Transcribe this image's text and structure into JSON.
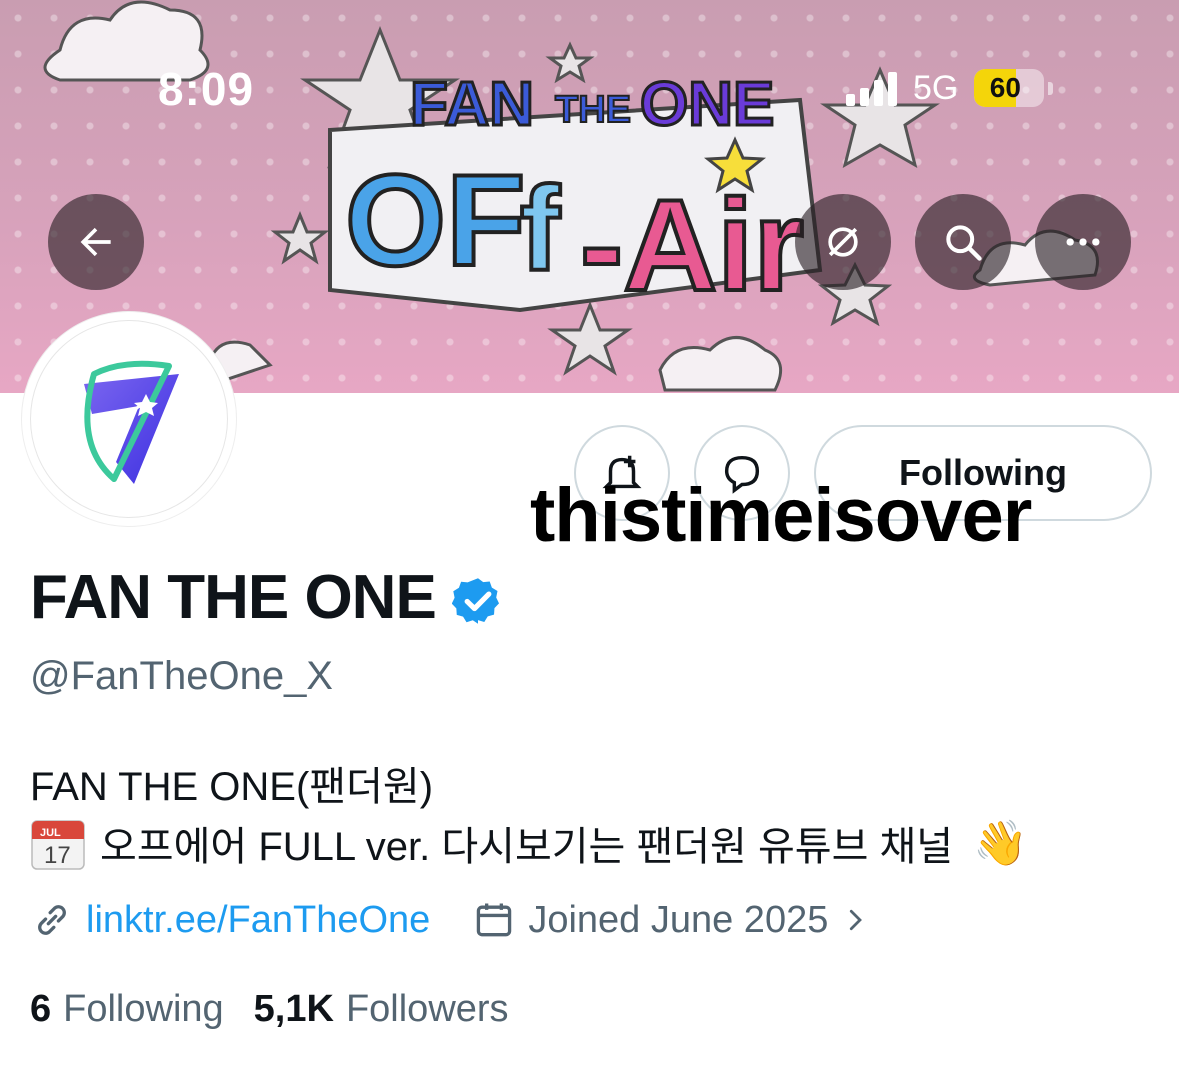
{
  "status_bar": {
    "time": "8:09",
    "network": "5G",
    "battery": "60",
    "battery_level": 0.6
  },
  "banner": {
    "title_top": "FAN THE ONE",
    "title_main": "OFF-Air"
  },
  "profile": {
    "display_name": "FAN THE ONE",
    "handle": "@FanTheOne_X",
    "bio_line1": "FAN THE ONE(팬더원)",
    "bio_line2": "오프에어 FULL ver. 다시보기는 팬더원 유튜브 채널",
    "calendar_emoji_month": "JUL",
    "calendar_emoji_day": "17",
    "wave_emoji": "👋",
    "link": "linktr.ee/FanTheOne",
    "joined": "Joined June 2025",
    "following_count": "6",
    "following_label": "Following",
    "followers_count": "5,1K",
    "followers_label": "Followers"
  },
  "actions": {
    "following_button": "Following"
  },
  "watermark": "thistimeisover",
  "colors": {
    "link": "#1d9bf0",
    "secondary_text": "#536471",
    "verified": "#1d9bf0",
    "banner_pink": "#dba3bd"
  }
}
